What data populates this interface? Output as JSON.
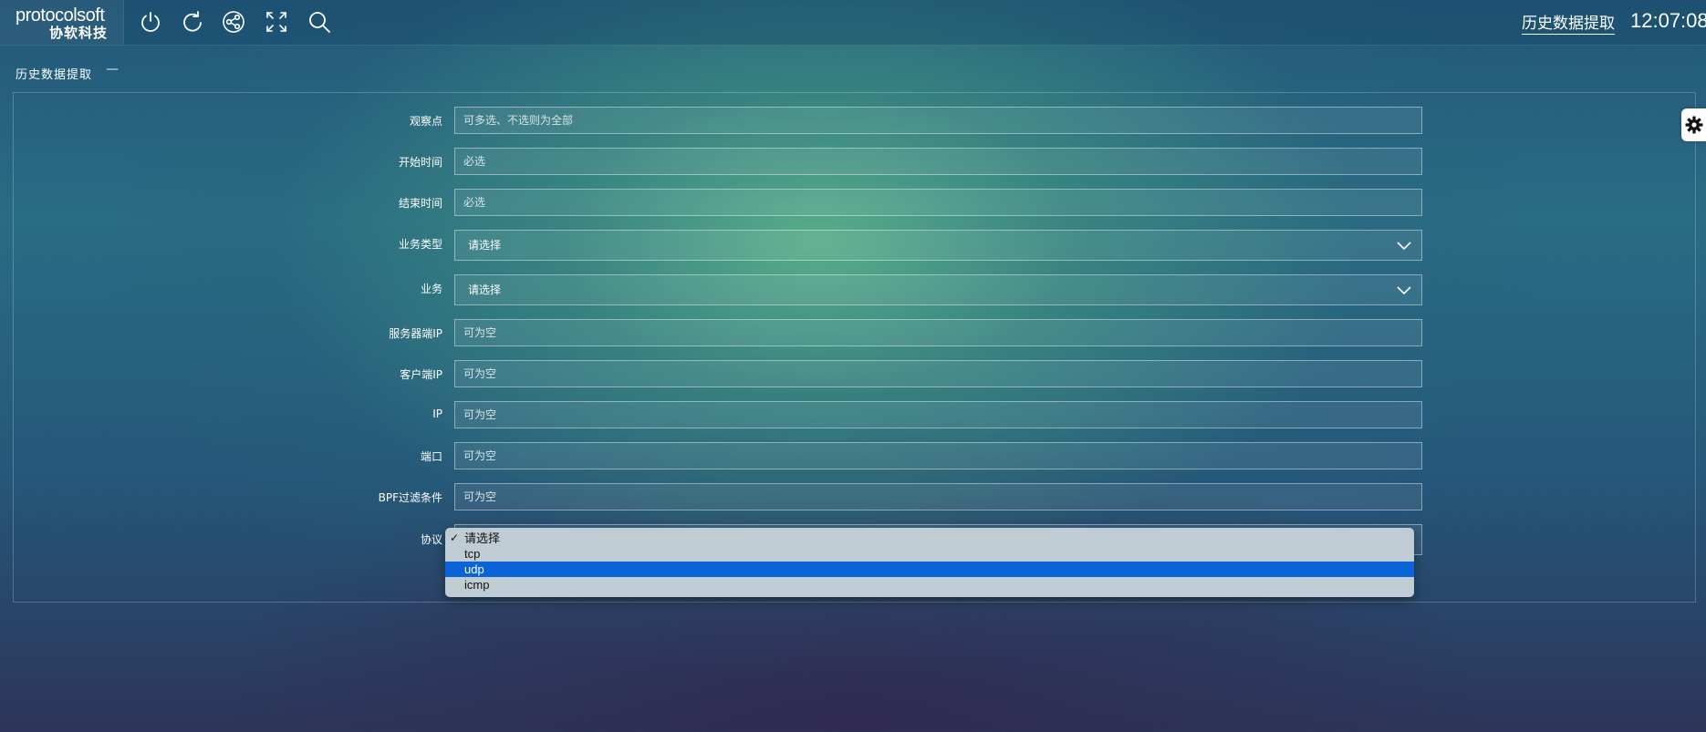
{
  "header": {
    "logo_text": "protocolsoft",
    "logo_subtext": "协软科技",
    "page_title": "历史数据提取",
    "clock": "12:07:08",
    "tools": [
      "power-icon",
      "refresh-icon",
      "share-icon",
      "fullscreen-icon",
      "search-icon"
    ]
  },
  "section": {
    "title": "历史数据提取",
    "collapse_symbol": "—"
  },
  "form": {
    "fields": [
      {
        "label": "观察点",
        "placeholder": "可多选、不选则为全部"
      },
      {
        "label": "开始时间",
        "placeholder": "必选"
      },
      {
        "label": "结束时间",
        "placeholder": "必选"
      },
      {
        "label": "业务类型",
        "value": "请选择"
      },
      {
        "label": "业务",
        "value": "请选择"
      },
      {
        "label": "服务器端IP",
        "placeholder": "可为空"
      },
      {
        "label": "客户端IP",
        "placeholder": "可为空"
      },
      {
        "label": "IP",
        "placeholder": "可为空"
      },
      {
        "label": "端口",
        "placeholder": "可为空"
      },
      {
        "label": "BPF过滤条件",
        "placeholder": "可为空"
      },
      {
        "label": "协议"
      }
    ]
  },
  "protocol_dropdown": {
    "checkmark": "✓",
    "options": [
      "请选择",
      "tcp",
      "udp",
      "icmp"
    ],
    "checked": "请选择",
    "highlighted": "udp"
  },
  "colors": {
    "highlight": "#0a64d8",
    "dropdown_bg": "#c0ccd3"
  }
}
